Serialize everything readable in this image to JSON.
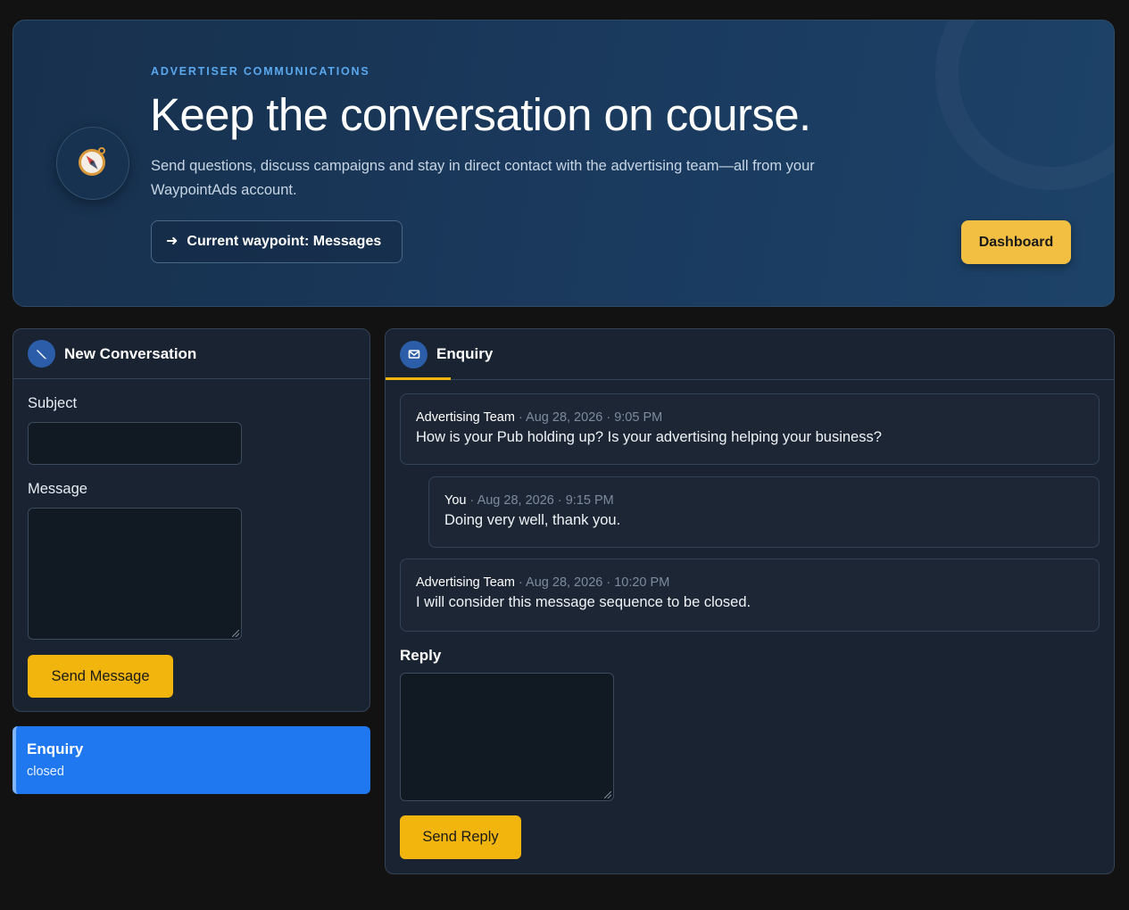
{
  "hero": {
    "eyebrow": "ADVERTISER COMMUNICATIONS",
    "title": "Keep the conversation on course.",
    "description": "Send questions, discuss campaigns and stay in direct contact with the advertising team—all from your WaypointAds account.",
    "waypoint_label": "Current waypoint: Messages",
    "dashboard_label": "Dashboard",
    "emblem_icon": "compass-icon"
  },
  "new_conversation": {
    "title": "New Conversation",
    "icon": "pencil-icon",
    "subject_label": "Subject",
    "subject_value": "",
    "message_label": "Message",
    "message_value": "",
    "send_label": "Send Message"
  },
  "conversations": [
    {
      "title": "Enquiry",
      "status": "closed",
      "selected": true
    }
  ],
  "thread": {
    "title": "Enquiry",
    "icon": "envelope-icon",
    "messages": [
      {
        "author": "Advertising Team",
        "timestamp": "Aug 28, 2026 · 9:05 PM",
        "body": "How is your Pub holding up? Is your advertising helping your business?"
      },
      {
        "author": "You",
        "timestamp": "Aug 28, 2026 · 9:15 PM",
        "body": "Doing very well, thank you."
      },
      {
        "author": "Advertising Team",
        "timestamp": "Aug 28, 2026 · 10:20 PM",
        "body": "I will consider this message sequence to be closed."
      }
    ],
    "reply_label": "Reply",
    "reply_value": "",
    "send_reply_label": "Send Reply"
  },
  "colors": {
    "accent_yellow": "#f2b50d",
    "selected_blue": "#1f78f0",
    "eyebrow_blue": "#5aa8ee"
  }
}
